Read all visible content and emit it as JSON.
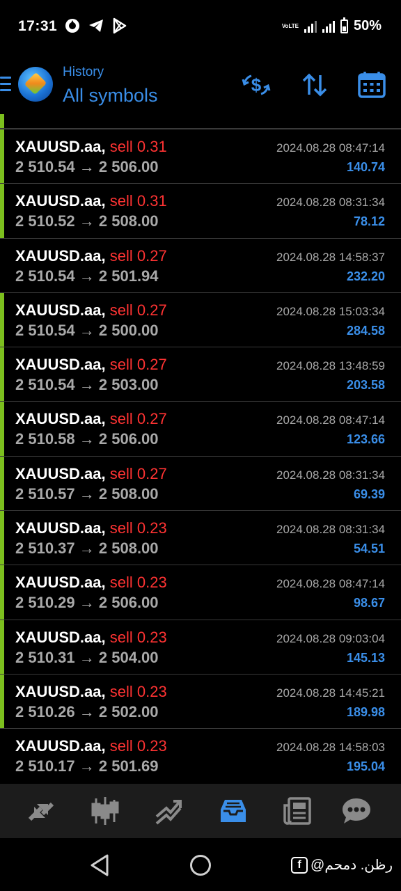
{
  "status_bar": {
    "time": "17:31",
    "left_icons": [
      "vpn-icon",
      "telegram-icon",
      "play-store-icon"
    ],
    "network": "VoLTE",
    "battery": "50%",
    "battery_level": 0.5
  },
  "header": {
    "subtitle": "History",
    "title": "All symbols",
    "actions": [
      "deposit-exchange-icon",
      "sort-icon",
      "calendar-icon"
    ],
    "accent_color": "#3a8ee8"
  },
  "trades": [
    {
      "symbol": "XAUUSD.aa,",
      "side": "sell",
      "volume": "0.31",
      "open": "2 510.54",
      "close": "2 506.00",
      "time": "2024.08.28 08:47:14",
      "profit": "140.74",
      "marked": true
    },
    {
      "symbol": "XAUUSD.aa,",
      "side": "sell",
      "volume": "0.31",
      "open": "2 510.52",
      "close": "2 508.00",
      "time": "2024.08.28 08:31:34",
      "profit": "78.12",
      "marked": true
    },
    {
      "symbol": "XAUUSD.aa,",
      "side": "sell",
      "volume": "0.27",
      "open": "2 510.54",
      "close": "2 501.94",
      "time": "2024.08.28 14:58:37",
      "profit": "232.20",
      "marked": false
    },
    {
      "symbol": "XAUUSD.aa,",
      "side": "sell",
      "volume": "0.27",
      "open": "2 510.54",
      "close": "2 500.00",
      "time": "2024.08.28 15:03:34",
      "profit": "284.58",
      "marked": true
    },
    {
      "symbol": "XAUUSD.aa,",
      "side": "sell",
      "volume": "0.27",
      "open": "2 510.54",
      "close": "2 503.00",
      "time": "2024.08.28 13:48:59",
      "profit": "203.58",
      "marked": true
    },
    {
      "symbol": "XAUUSD.aa,",
      "side": "sell",
      "volume": "0.27",
      "open": "2 510.58",
      "close": "2 506.00",
      "time": "2024.08.28 08:47:14",
      "profit": "123.66",
      "marked": true
    },
    {
      "symbol": "XAUUSD.aa,",
      "side": "sell",
      "volume": "0.27",
      "open": "2 510.57",
      "close": "2 508.00",
      "time": "2024.08.28 08:31:34",
      "profit": "69.39",
      "marked": true
    },
    {
      "symbol": "XAUUSD.aa,",
      "side": "sell",
      "volume": "0.23",
      "open": "2 510.37",
      "close": "2 508.00",
      "time": "2024.08.28 08:31:34",
      "profit": "54.51",
      "marked": true
    },
    {
      "symbol": "XAUUSD.aa,",
      "side": "sell",
      "volume": "0.23",
      "open": "2 510.29",
      "close": "2 506.00",
      "time": "2024.08.28 08:47:14",
      "profit": "98.67",
      "marked": true
    },
    {
      "symbol": "XAUUSD.aa,",
      "side": "sell",
      "volume": "0.23",
      "open": "2 510.31",
      "close": "2 504.00",
      "time": "2024.08.28 09:03:04",
      "profit": "145.13",
      "marked": true
    },
    {
      "symbol": "XAUUSD.aa,",
      "side": "sell",
      "volume": "0.23",
      "open": "2 510.26",
      "close": "2 502.00",
      "time": "2024.08.28 14:45:21",
      "profit": "189.98",
      "marked": true
    },
    {
      "symbol": "XAUUSD.aa,",
      "side": "sell",
      "volume": "0.23",
      "open": "2 510.17",
      "close": "2 501.69",
      "time": "2024.08.28 14:58:03",
      "profit": "195.04",
      "marked": false
    }
  ],
  "arrow": "→",
  "colors": {
    "sell": "#ff3333",
    "profit": "#3a8ee8",
    "marker": "#7cbf1e",
    "muted": "#a9a9a9"
  },
  "bottom_nav": {
    "items": [
      "quotes-icon",
      "chart-icon",
      "trade-icon",
      "history-icon",
      "news-icon",
      "messages-icon"
    ],
    "active": "history-icon"
  },
  "watermark": {
    "fb_letter": "f",
    "text": "@رظن. دمحم"
  }
}
